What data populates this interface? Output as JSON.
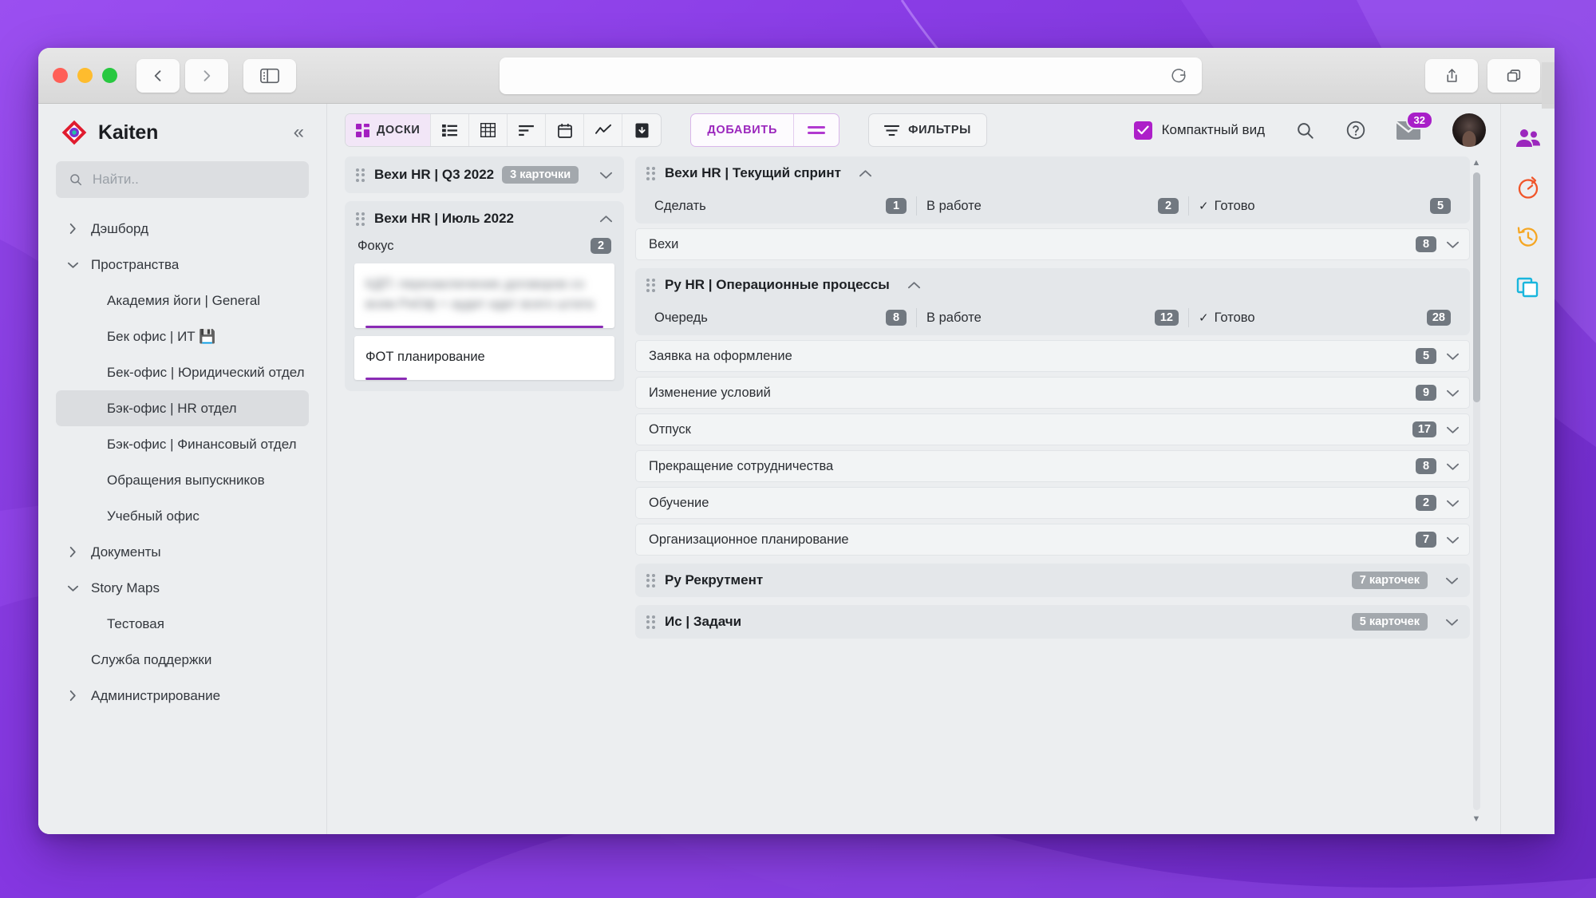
{
  "browser": {
    "back_icon": "chevron-left-icon",
    "forward_icon": "chevron-right-icon",
    "sidebar_toggle_icon": "sidebar-toggle-icon",
    "url_value": "",
    "reload_icon": "reload-icon",
    "share_icon": "share-icon",
    "tabs_icon": "tabs-icon",
    "new_tab_label": "+"
  },
  "sidebar": {
    "brand": "Kaiten",
    "collapse_label": "«",
    "search": {
      "placeholder": "Найти..",
      "value": ""
    },
    "items": [
      {
        "label": "Дэшборд",
        "level": 1,
        "caret": "right",
        "active": false
      },
      {
        "label": "Пространства",
        "level": 1,
        "caret": "down",
        "active": false
      },
      {
        "label": "Академия йоги | General",
        "level": 2,
        "caret": "none",
        "active": false
      },
      {
        "label": "Бек офис | ИТ 💾",
        "level": 2,
        "caret": "none",
        "active": false
      },
      {
        "label": "Бек-офис | Юридический отдел",
        "level": 2,
        "caret": "none",
        "active": false
      },
      {
        "label": "Бэк-офис | HR отдел",
        "level": 2,
        "caret": "none",
        "active": true
      },
      {
        "label": "Бэк-офис | Финансовый отдел",
        "level": 2,
        "caret": "none",
        "active": false
      },
      {
        "label": "Обращения выпускников",
        "level": 2,
        "caret": "none",
        "active": false
      },
      {
        "label": "Учебный офис",
        "level": 2,
        "caret": "none",
        "active": false
      },
      {
        "label": "Документы",
        "level": 1,
        "caret": "right",
        "active": false
      },
      {
        "label": "Story Maps",
        "level": 1,
        "caret": "down",
        "active": false
      },
      {
        "label": "Тестовая",
        "level": 2,
        "caret": "none",
        "active": false
      },
      {
        "label": "Служба поддержки",
        "level": 1,
        "caret": "none",
        "active": false
      },
      {
        "label": "Администрирование",
        "level": 1,
        "caret": "right",
        "active": false
      }
    ]
  },
  "toolbar": {
    "views": [
      {
        "label": "ДОСКИ",
        "icon": "boards-icon",
        "active": true
      },
      {
        "label": "",
        "icon": "list-icon",
        "active": false
      },
      {
        "label": "",
        "icon": "table-icon",
        "active": false
      },
      {
        "label": "",
        "icon": "sort-icon",
        "active": false
      },
      {
        "label": "",
        "icon": "calendar-icon",
        "active": false
      },
      {
        "label": "",
        "icon": "chart-icon",
        "active": false
      },
      {
        "label": "",
        "icon": "archive-icon",
        "active": false
      }
    ],
    "add_label": "ДОБАВИТЬ",
    "add_menu_icon": "equals-icon",
    "filters_label": "ФИЛЬТРЫ",
    "filters_icon": "filter-icon",
    "compact_label": "Компактный вид",
    "compact_checked": true,
    "search_icon": "search-icon",
    "help_icon": "help-icon",
    "mail_icon": "mail-icon",
    "mail_badge": "32",
    "avatar": "user-avatar"
  },
  "board": {
    "left_lane": {
      "header": {
        "title": "Вехи HR | Q3 2022",
        "cards_badge": "3 карточки",
        "chevron": "down"
      },
      "group": {
        "title": "Вехи HR | Июль 2022",
        "chevron": "up",
        "column": {
          "title": "Фокус",
          "count": "2"
        },
        "cards": [
          {
            "text": "КДП: перезаключение договоров со всем РиОф + аудит идет всего штата",
            "blurred": true,
            "bar": "full"
          },
          {
            "text": "ФОТ планирование",
            "blurred": false,
            "bar": "short"
          }
        ]
      }
    },
    "sections": [
      {
        "title": "Вехи HR | Текущий спринт",
        "chevron": "up",
        "columns": [
          {
            "label": "Сделать",
            "count": "1",
            "done": false
          },
          {
            "label": "В работе",
            "count": "2",
            "done": false
          },
          {
            "label": "Готово",
            "count": "5",
            "done": true
          }
        ],
        "rows": [
          {
            "label": "Вехи",
            "count": "8"
          }
        ]
      },
      {
        "title": "Ру HR | Операционные процессы",
        "chevron": "up",
        "columns": [
          {
            "label": "Очередь",
            "count": "8",
            "done": false
          },
          {
            "label": "В работе",
            "count": "12",
            "done": false
          },
          {
            "label": "Готово",
            "count": "28",
            "done": true
          }
        ],
        "rows": [
          {
            "label": "Заявка на оформление",
            "count": "5"
          },
          {
            "label": "Изменение условий",
            "count": "9"
          },
          {
            "label": "Отпуск",
            "count": "17"
          },
          {
            "label": "Прекращение сотрудничества",
            "count": "8"
          },
          {
            "label": "Обучение",
            "count": "2"
          },
          {
            "label": "Организационное планирование",
            "count": "7"
          }
        ]
      },
      {
        "title": "Ру Рекрутмент",
        "chevron": "down",
        "cards_badge": "7 карточек",
        "collapsed": true,
        "columns": [],
        "rows": []
      },
      {
        "title": "Ис | Задачи",
        "chevron": "down",
        "cards_badge": "5 карточек",
        "collapsed": true,
        "columns": [],
        "rows": []
      }
    ]
  },
  "rail": {
    "items": [
      {
        "icon": "people-icon",
        "color": "#9b27bd"
      },
      {
        "icon": "timer-icon",
        "color": "#f0552a"
      },
      {
        "icon": "history-icon",
        "color": "#f5a623"
      },
      {
        "icon": "copy-icon",
        "color": "#19b6dd"
      }
    ]
  }
}
